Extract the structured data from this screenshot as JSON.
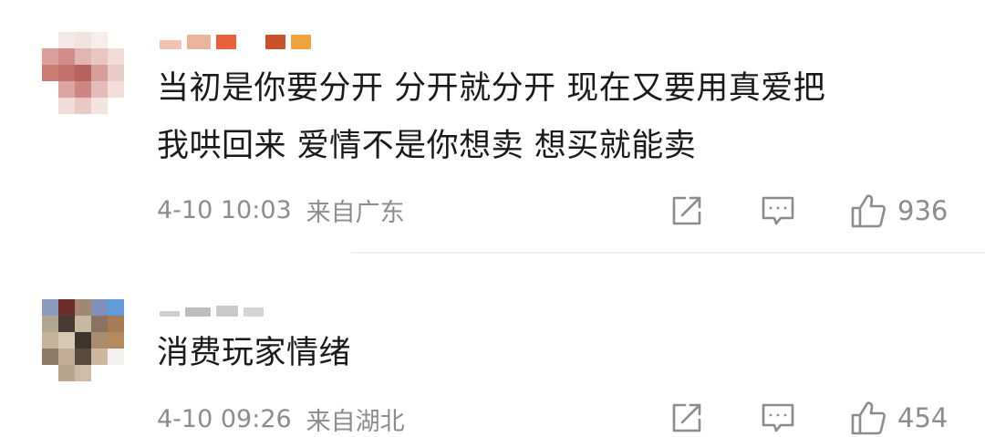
{
  "comments": [
    {
      "text_lines": [
        "当初是你要分开 分开就分开 现在又要用真爱把",
        "我哄回来 爱情不是你想卖 想买就能卖"
      ],
      "date": "4-10 10:03",
      "location": "来自广东",
      "icons": {
        "share": "share-icon",
        "reply": "comment-icon",
        "like": "thumbs-up-icon"
      },
      "likes": "936"
    },
    {
      "text_lines": [
        "消费玩家情绪"
      ],
      "date": "4-10 09:26",
      "location": "来自湖北",
      "icons": {
        "share": "share-icon",
        "reply": "comment-icon",
        "like": "thumbs-up-icon"
      },
      "likes": "454"
    }
  ]
}
